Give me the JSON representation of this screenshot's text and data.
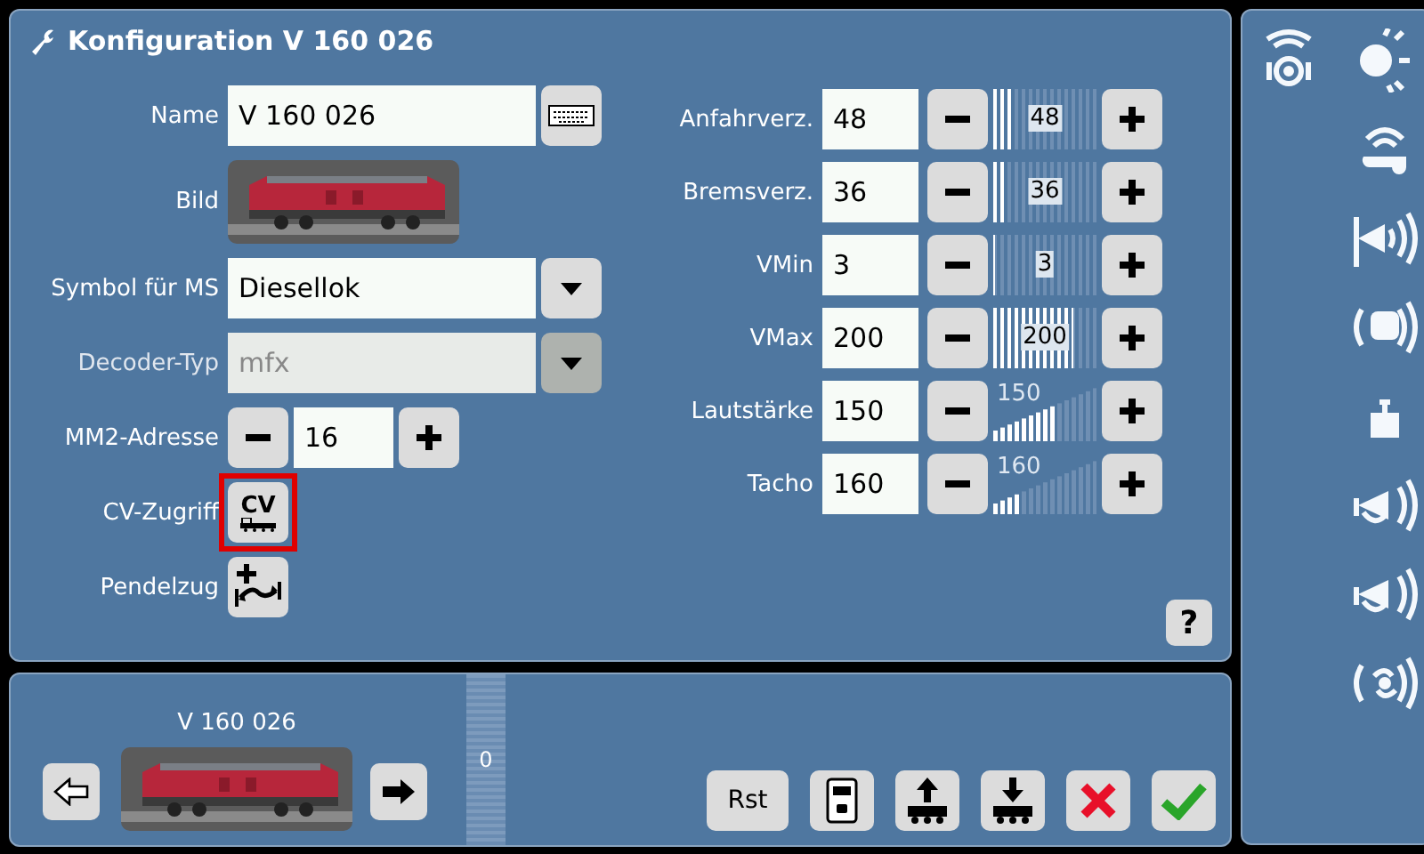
{
  "window": {
    "title": "Konfiguration V 160 026"
  },
  "form": [
    {
      "kind": "text",
      "label": "Name",
      "value": "V 160 026"
    },
    {
      "kind": "picture",
      "label": "Bild"
    },
    {
      "kind": "select",
      "label": "Symbol für MS",
      "value": "Diesellok",
      "disabled": false
    },
    {
      "kind": "select",
      "label": "Decoder-Typ",
      "value": "mfx",
      "disabled": true
    },
    {
      "kind": "stepper",
      "label": "MM2-Adresse",
      "value": "16"
    },
    {
      "kind": "cv",
      "label": "CV-Zugriff",
      "button": "CV",
      "highlighted": true
    },
    {
      "kind": "shuttle",
      "label": "Pendelzug"
    }
  ],
  "settings": [
    {
      "kind": "bar",
      "label": "Anfahrverz.",
      "value": "48",
      "reading": "48",
      "level": 0.19
    },
    {
      "kind": "bar",
      "label": "Bremsverz.",
      "value": "36",
      "reading": "36",
      "level": 0.14
    },
    {
      "kind": "bar",
      "label": "VMin",
      "value": "3",
      "reading": "3",
      "level": 0.02
    },
    {
      "kind": "bar",
      "label": "VMax",
      "value": "200",
      "reading": "200",
      "level": 0.78
    },
    {
      "kind": "ramp",
      "label": "Lautstärke",
      "value": "150",
      "reading": "150",
      "level": 0.59
    },
    {
      "kind": "ramp",
      "label": "Tacho",
      "value": "160",
      "reading": "160",
      "level": 0.25
    }
  ],
  "help": "?",
  "bottom": {
    "loco_name": "V 160 026",
    "speed_slider": {
      "reading": "0",
      "level": 0
    },
    "reset": "Rst"
  }
}
